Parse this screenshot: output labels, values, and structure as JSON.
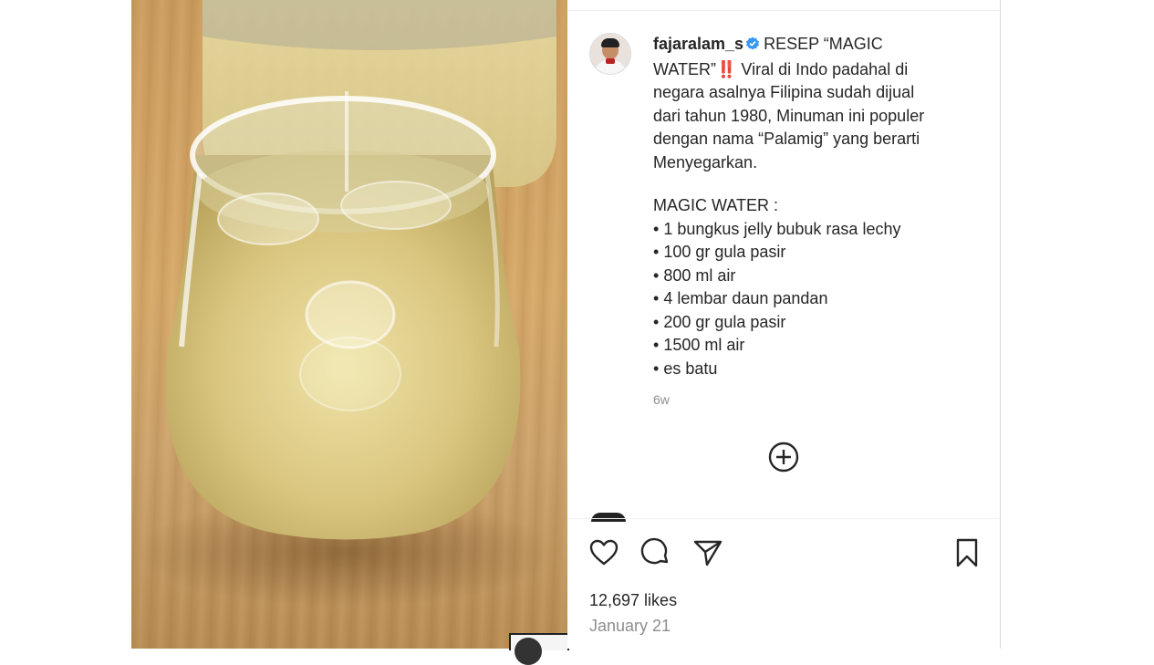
{
  "post": {
    "username": "fajaralam_s",
    "caption_lines": [
      "RESEP “MAGIC",
      "WATER”‼️ Viral di Indo padahal di",
      "negara asalnya Filipina sudah dijual",
      "dari tahun 1980, Minuman ini populer",
      "dengan nama “Palamig” yang berarti",
      "Menyegarkan."
    ],
    "recipe_title": "MAGIC WATER :",
    "recipe_items": [
      "1 bungkus jelly bubuk rasa lechy",
      "100 gr gula pasir",
      "800 ml air",
      "4 lembar daun pandan",
      "200 gr gula pasir",
      "1500 ml air",
      "es batu"
    ],
    "time_ago": "6w",
    "likes": "12,697 likes",
    "date": "January 21"
  },
  "icons": {
    "verified": "verified-badge-icon",
    "more": "plus-circle-icon",
    "like": "heart-icon",
    "comment": "comment-icon",
    "share": "paper-plane-icon",
    "save": "bookmark-icon"
  },
  "colors": {
    "verified": "#3897f0",
    "text": "#262626",
    "muted": "#8e8e8e"
  }
}
